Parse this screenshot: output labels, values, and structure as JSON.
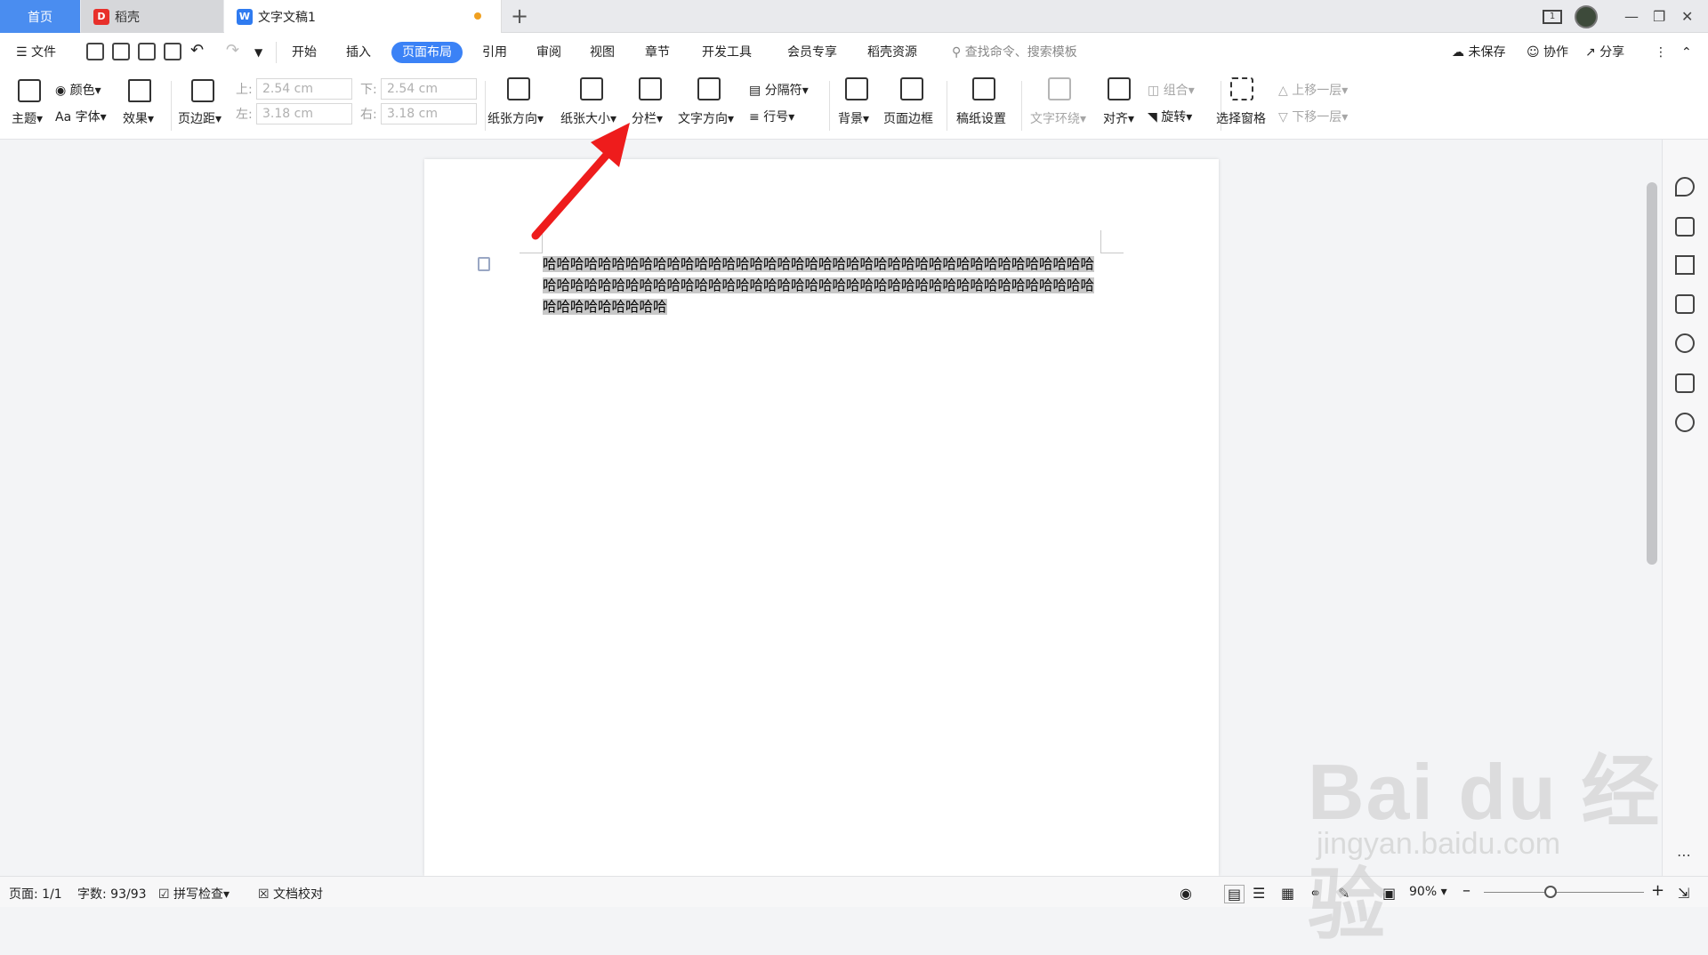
{
  "tabs": {
    "home": "首页",
    "daoke": "稻壳",
    "doc": "文字文稿1",
    "doc_badge": "W",
    "daoke_badge": "D"
  },
  "window": {
    "page_count_badge": "1"
  },
  "menu": {
    "file": "文件",
    "items": [
      "开始",
      "插入",
      "页面布局",
      "引用",
      "审阅",
      "视图",
      "章节",
      "开发工具",
      "会员专享",
      "稻壳资源"
    ],
    "active": "页面布局",
    "search_placeholder": "查找命令、搜索模板",
    "unsaved": "未保存",
    "collab": "协作",
    "share": "分享"
  },
  "ribbon": {
    "theme": "主题",
    "color": "颜色",
    "font": "字体",
    "effect": "效果",
    "margin": "页边距",
    "top_label": "上:",
    "bottom_label": "下:",
    "left_label": "左:",
    "right_label": "右:",
    "top_value": "2.54 cm",
    "bottom_value": "2.54 cm",
    "left_value": "3.18 cm",
    "right_value": "3.18 cm",
    "orientation": "纸张方向",
    "size": "纸张大小",
    "columns": "分栏",
    "text_direction": "文字方向",
    "separator": "分隔符",
    "line_number": "行号",
    "background": "背景",
    "page_border": "页面边框",
    "manuscript": "稿纸设置",
    "text_wrap": "文字环绕",
    "align": "对齐",
    "rotate": "旋转",
    "group": "组合",
    "selection_pane": "选择窗格",
    "bring_forward": "上移一层",
    "send_backward": "下移一层"
  },
  "document": {
    "text": "哈哈哈哈哈哈哈哈哈哈哈哈哈哈哈哈哈哈哈哈哈哈哈哈哈哈哈哈哈哈哈哈哈哈哈哈哈哈哈哈哈哈哈哈哈哈哈哈哈哈哈哈哈哈哈哈哈哈哈哈哈哈哈哈哈哈哈哈哈哈哈哈哈哈哈哈哈哈哈哈哈哈哈哈哈哈哈哈哈"
  },
  "status": {
    "page": "页面: 1/1",
    "words": "字数: 93/93",
    "spell": "拼写检查",
    "proof": "文档校对",
    "zoom": "90%"
  },
  "watermark": {
    "brand": "Bai du 经验",
    "url": "jingyan.baidu.com"
  },
  "colors": {
    "accent": "#3b82f6",
    "arrow": "#ee1c1c",
    "selection": "#c8c8c8"
  }
}
